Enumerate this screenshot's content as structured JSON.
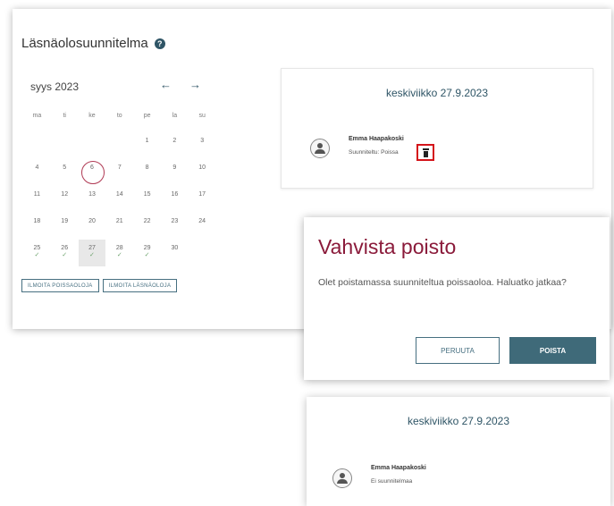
{
  "planner": {
    "title": "Läsnäolosuunnitelma",
    "help_icon": "?",
    "month": "syys 2023",
    "prev_arrow": "←",
    "next_arrow": "→",
    "weekdays": [
      "ma",
      "ti",
      "ke",
      "to",
      "pe",
      "la",
      "su"
    ],
    "weeks": [
      [
        "",
        "",
        "",
        "",
        "1",
        "2",
        "3"
      ],
      [
        "4",
        "5",
        "6",
        "7",
        "8",
        "9",
        "10"
      ],
      [
        "11",
        "12",
        "13",
        "14",
        "15",
        "16",
        "17"
      ],
      [
        "18",
        "19",
        "20",
        "21",
        "22",
        "23",
        "24"
      ],
      [
        "25",
        "26",
        "27",
        "28",
        "29",
        "30",
        ""
      ]
    ],
    "check_mark": "✓",
    "buttons": {
      "report_absence": "ILMOITA POISSAOLOJA",
      "report_presence": "ILMOITA LÄSNÄOLOJA"
    }
  },
  "day_card": {
    "date": "keskiviikko 27.9.2023",
    "person_name": "Emma Haapakoski",
    "status": "Suunniteltu: Poissa"
  },
  "dialog": {
    "title": "Vahvista poisto",
    "message": "Olet poistamassa suunniteltua poissaoloa. Haluatko jatkaa?",
    "cancel": "PERUUTA",
    "confirm": "POISTA"
  },
  "day_card_after": {
    "date": "keskiviikko 27.9.2023",
    "person_name": "Emma Haapakoski",
    "status": "Ei suunnitelmaa"
  }
}
